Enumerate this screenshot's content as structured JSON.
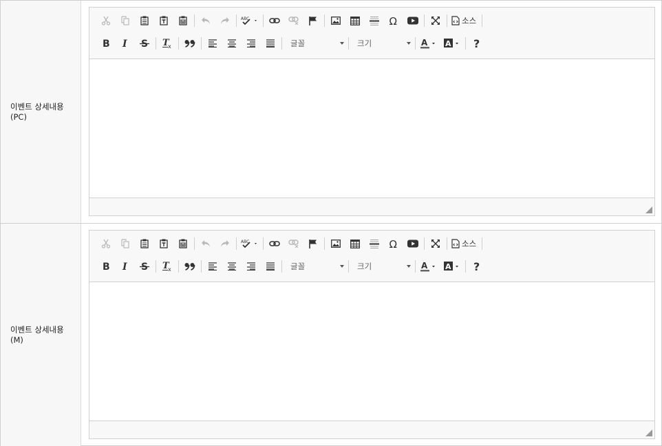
{
  "rows": [
    {
      "label": "이벤트 상세내용\n(PC)",
      "label_line1": "이벤트 상세내용",
      "label_line2": "(PC)"
    },
    {
      "label": "이벤트 상세내용\n(M)",
      "label_line1": "이벤트 상세내용",
      "label_line2": "(M)"
    }
  ],
  "editor": {
    "font_combo": "글꼴",
    "size_combo": "크기",
    "source_label": "소스",
    "toolbar1_icons": [
      "cut-icon",
      "copy-icon",
      "paste-icon",
      "paste-text-icon",
      "paste-word-icon",
      "undo-icon",
      "redo-icon",
      "spellcheck-icon",
      "link-icon",
      "unlink-icon",
      "anchor-icon",
      "image-icon",
      "table-icon",
      "horizontal-rule-icon",
      "special-char-icon",
      "youtube-icon",
      "maximize-icon",
      "source-icon"
    ],
    "toolbar2_icons": [
      "bold-icon",
      "italic-icon",
      "strike-icon",
      "remove-format-icon",
      "blockquote-icon",
      "align-left-icon",
      "align-center-icon",
      "align-right-icon",
      "justify-icon",
      "text-color-icon",
      "bg-color-icon",
      "help-icon"
    ]
  },
  "colors": {
    "border": "#d1d1d1",
    "toolbar_bg": "#f8f8f8",
    "label_bg": "#f7f7f7",
    "disabled_icon": "#b8b8b8"
  }
}
